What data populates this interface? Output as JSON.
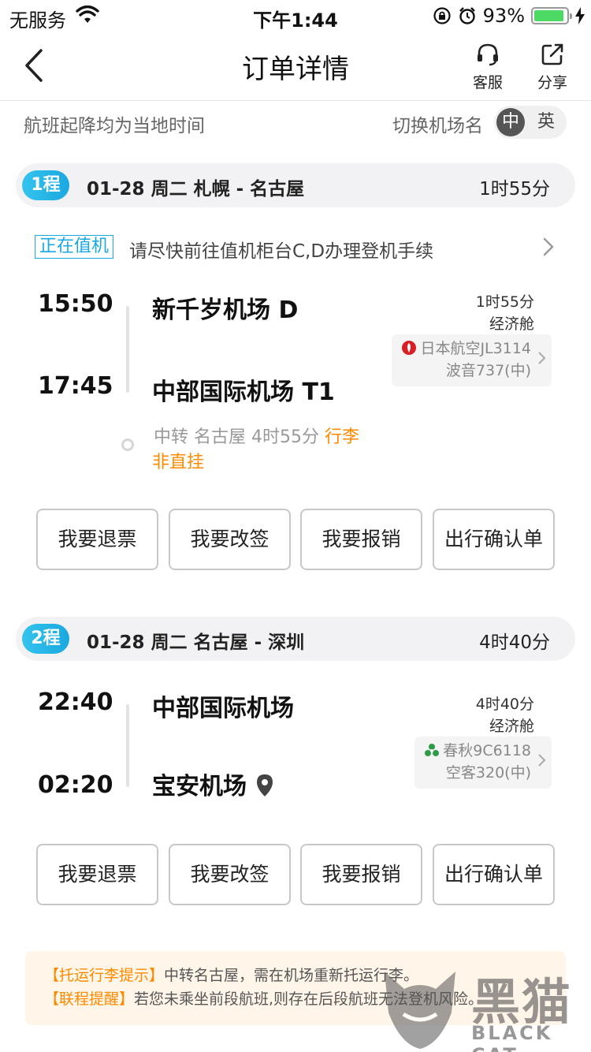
{
  "status_bar": {
    "carrier": "无服务",
    "time": "下午1:44",
    "battery_pct": "93%",
    "battery_level": 0.93
  },
  "nav": {
    "title": "订单详情",
    "customer_service": "客服",
    "share": "分享"
  },
  "notice": {
    "tz_note": "航班起降均为当地时间",
    "switch_label": "切换机场名",
    "lang_selected": "中",
    "lang_other": "英"
  },
  "segments": [
    {
      "badge": "1程",
      "route": "01-28  周二  札幌 - 名古屋",
      "duration": "1时55分",
      "checkin_tag": "正在值机",
      "checkin_text": "请尽快前往值机柜台C,D办理登机手续",
      "dep_time": "15:50",
      "dep_airport": "新千岁机场 D",
      "arr_time": "17:45",
      "arr_airport": "中部国际机场 T1",
      "flight_duration": "1时55分",
      "cabin": "经济舱",
      "airline": "日本航空JL3114",
      "aircraft": "波音737(中)",
      "transfer_prefix": "中转  名古屋  4时55分 ",
      "transfer_tag": "行李",
      "transfer_note": "非直挂"
    },
    {
      "badge": "2程",
      "route": "01-28  周二  名古屋 - 深圳",
      "duration": "4时40分",
      "dep_time": "22:40",
      "dep_airport": "中部国际机场",
      "arr_time": "02:20",
      "arr_airport": "宝安机场",
      "flight_duration": "4时40分",
      "cabin": "经济舱",
      "airline": "春秋9C6118",
      "aircraft": "空客320(中)"
    }
  ],
  "actions": {
    "refund": "我要退票",
    "change": "我要改签",
    "reimburse": "我要报销",
    "itinerary": "出行确认单"
  },
  "tips": {
    "baggage_tag": "【托运行李提示】",
    "baggage_text": "中转名古屋，需在机场重新托运行李。",
    "connect_tag": "【联程提醒】",
    "connect_text": "若您未乘坐前段航班,则存在后段航班无法登机风险。"
  },
  "watermark": {
    "cn": "黑猫",
    "en": "BLACK CAT"
  },
  "colors": {
    "accent": "#1aa8e0",
    "orange": "#ff8a00",
    "battery": "#4cd964"
  }
}
